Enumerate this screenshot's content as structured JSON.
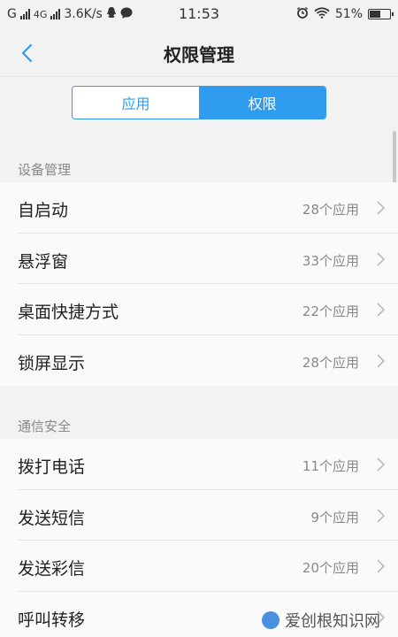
{
  "status_bar": {
    "carrier1": "G",
    "carrier2": "4G",
    "speed": "3.6K/s",
    "time": "11:53",
    "battery": "51%",
    "battery_level": 0.51
  },
  "header": {
    "title": "权限管理"
  },
  "tabs": [
    {
      "label": "应用",
      "active": false
    },
    {
      "label": "权限",
      "active": true
    }
  ],
  "sections": [
    {
      "title": "设备管理",
      "items": [
        {
          "label": "自启动",
          "count": "28个应用"
        },
        {
          "label": "悬浮窗",
          "count": "33个应用"
        },
        {
          "label": "桌面快捷方式",
          "count": "22个应用"
        },
        {
          "label": "锁屏显示",
          "count": "28个应用"
        }
      ]
    },
    {
      "title": "通信安全",
      "items": [
        {
          "label": "拨打电话",
          "count": "11个应用"
        },
        {
          "label": "发送短信",
          "count": "9个应用"
        },
        {
          "label": "发送彩信",
          "count": "20个应用"
        },
        {
          "label": "呼叫转移",
          "count": ""
        }
      ]
    }
  ],
  "watermark": "爱创根知识网",
  "colors": {
    "accent": "#2f9cf0"
  }
}
